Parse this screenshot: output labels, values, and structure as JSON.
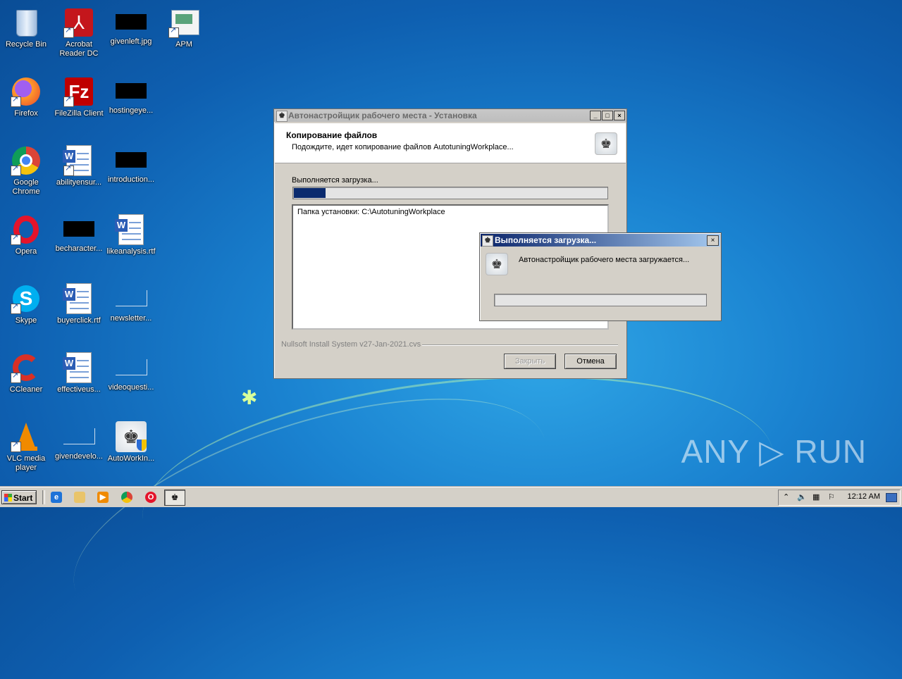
{
  "desktop_icons": [
    {
      "label": "Recycle Bin",
      "name": "recycle-bin-icon"
    },
    {
      "label": "Acrobat\nReader DC",
      "name": "acrobat-reader-icon"
    },
    {
      "label": "givenleft.jpg",
      "name": "givenleft-file-icon"
    },
    {
      "label": "APM",
      "name": "apm-icon"
    },
    {
      "label": "Firefox",
      "name": "firefox-icon"
    },
    {
      "label": "FileZilla Client",
      "name": "filezilla-icon"
    },
    {
      "label": "hostingeye...",
      "name": "hostingeye-file-icon"
    },
    {
      "label": "Google\nChrome",
      "name": "chrome-icon"
    },
    {
      "label": "abilityensur...",
      "name": "abilityensur-doc-icon"
    },
    {
      "label": "introduction...",
      "name": "introduction-file-icon"
    },
    {
      "label": "Opera",
      "name": "opera-icon"
    },
    {
      "label": "becharacter...",
      "name": "becharacter-file-icon"
    },
    {
      "label": "likeanalysis.rtf",
      "name": "likeanalysis-doc-icon"
    },
    {
      "label": "Skype",
      "name": "skype-icon"
    },
    {
      "label": "buyerclick.rtf",
      "name": "buyerclick-doc-icon"
    },
    {
      "label": "newsletter...",
      "name": "newsletter-file-icon"
    },
    {
      "label": "CCleaner",
      "name": "ccleaner-icon"
    },
    {
      "label": "effectiveus...",
      "name": "effectiveus-doc-icon"
    },
    {
      "label": "videoquesti...",
      "name": "videoquesti-file-icon"
    },
    {
      "label": "VLC media\nplayer",
      "name": "vlc-icon"
    },
    {
      "label": "givendevelo...",
      "name": "givendevelo-file-icon"
    },
    {
      "label": "AutoWorkIn...",
      "name": "autoworkin-installer-icon"
    }
  ],
  "installer": {
    "title": "Автонастройщик рабочего места - Установка",
    "header_title": "Копирование файлов",
    "header_subtitle": "Подождите, идет копирование файлов AutotuningWorkplace...",
    "status": "Выполняется загрузка...",
    "progress_fraction": 0.1,
    "log_line": "Папка установки: C:\\AutotuningWorkplace",
    "branding": "Nullsoft Install System v27-Jan-2021.cvs",
    "close_label": "Закрыть",
    "cancel_label": "Отмена",
    "min_glyph": "_",
    "max_glyph": "□",
    "close_glyph": "×"
  },
  "popup": {
    "title": "Выполняется загрузка...",
    "message": "Автонастройщик рабочего места загружается...",
    "progress_fraction": 0,
    "close_glyph": "×"
  },
  "taskbar": {
    "start_label": "Start",
    "clock": "12:12 AM"
  },
  "watermark": "ANY ▷ RUN"
}
